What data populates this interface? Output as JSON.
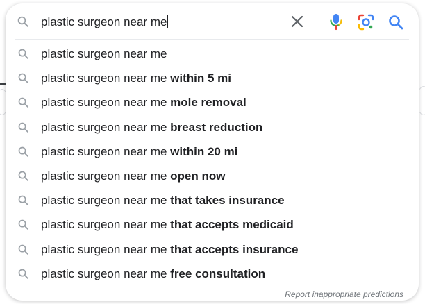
{
  "search": {
    "query": "plastic surgeon near me"
  },
  "suggestions": [
    {
      "prefix": "plastic surgeon near me",
      "bold": ""
    },
    {
      "prefix": "plastic surgeon near me ",
      "bold": "within 5 mi"
    },
    {
      "prefix": "plastic surgeon near me ",
      "bold": "mole removal"
    },
    {
      "prefix": "plastic surgeon near me ",
      "bold": "breast reduction"
    },
    {
      "prefix": "plastic surgeon near me ",
      "bold": "within 20 mi"
    },
    {
      "prefix": "plastic surgeon near me ",
      "bold": "open now"
    },
    {
      "prefix": "plastic surgeon near me ",
      "bold": "that takes insurance"
    },
    {
      "prefix": "plastic surgeon near me ",
      "bold": "that accepts medicaid"
    },
    {
      "prefix": "plastic surgeon near me ",
      "bold": "that accepts insurance"
    },
    {
      "prefix": "plastic surgeon near me ",
      "bold": "free consultation"
    }
  ],
  "footer": {
    "report_label": "Report inappropriate predictions"
  },
  "colors": {
    "icon_gray": "#9aa0a6",
    "google_blue": "#4285f4",
    "google_red": "#ea4335",
    "google_yellow": "#fbbc05",
    "google_green": "#34a853"
  }
}
